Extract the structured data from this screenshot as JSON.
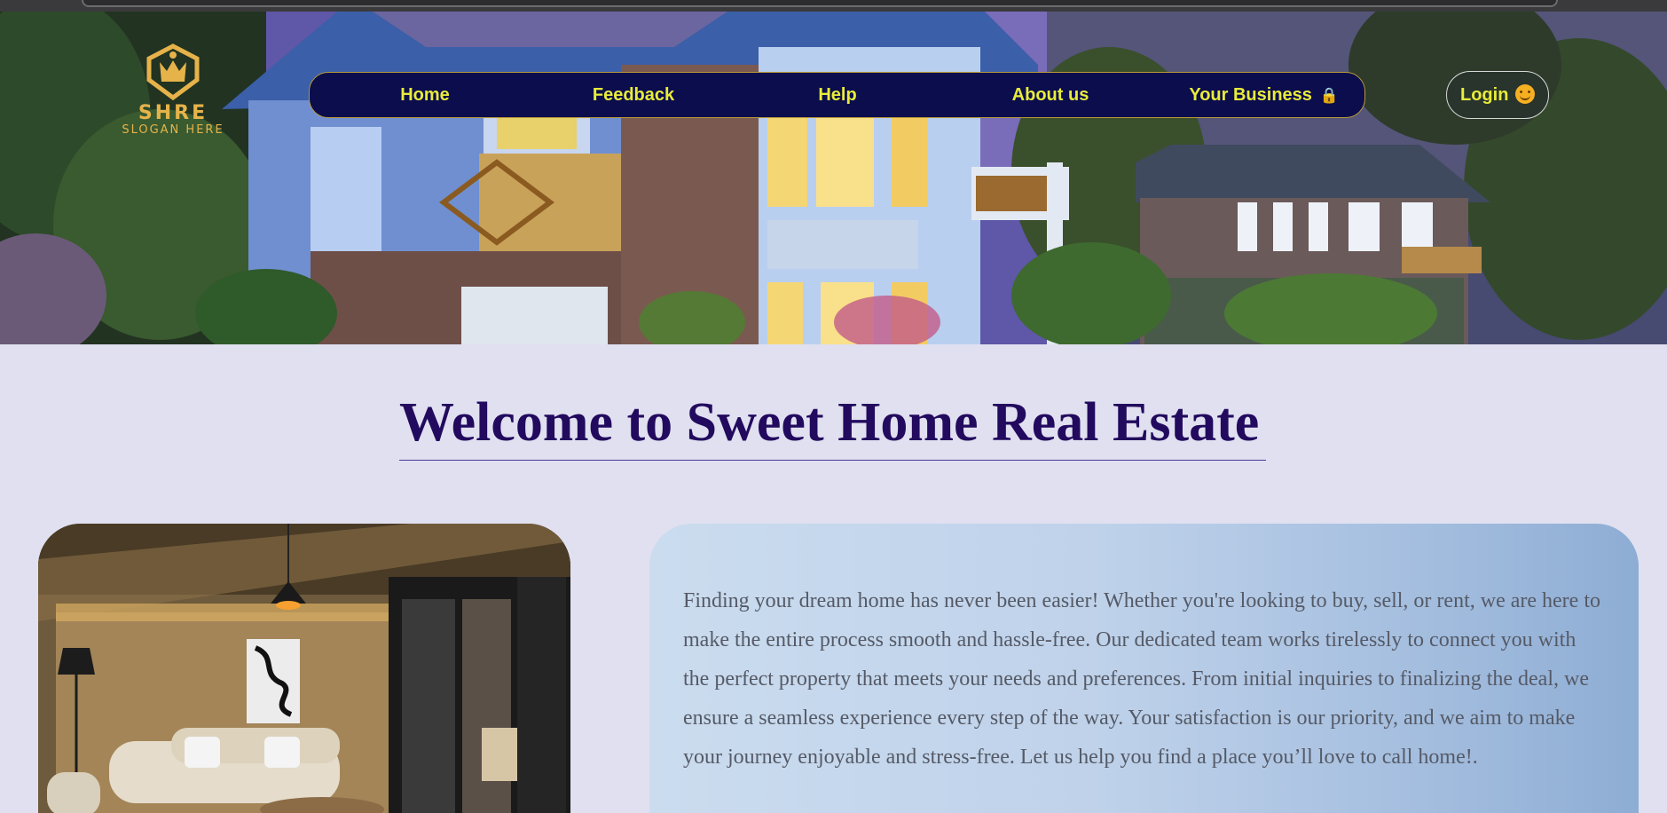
{
  "logo": {
    "name": "SHRE",
    "slogan": "SLOGAN HERE",
    "accent_color": "#e6b34a"
  },
  "nav": {
    "items": [
      {
        "label": "Home"
      },
      {
        "label": "Feedback"
      },
      {
        "label": "Help"
      },
      {
        "label": "About us"
      },
      {
        "label": "Your Business",
        "icon": "lock-icon"
      }
    ],
    "text_color": "#e8ec3a",
    "background": "#0b0d4c"
  },
  "login": {
    "label": "Login",
    "icon": "smiley-icon"
  },
  "main": {
    "title": "Welcome to Sweet Home Real Estate",
    "title_color": "#220a5e",
    "intro": "Finding your dream home has never been easier! Whether you're looking to buy, sell, or rent, we are here to make the entire process smooth and hassle-free. Our dedicated team works tirelessly to connect you with the perfect property that meets your needs and preferences. From initial inquiries to finalizing the deal, we ensure a seamless experience every step of the way. Your satisfaction is our priority, and we aim to make your journey enjoyable and stress-free. Let us help you find a place you’ll love to call home!."
  }
}
